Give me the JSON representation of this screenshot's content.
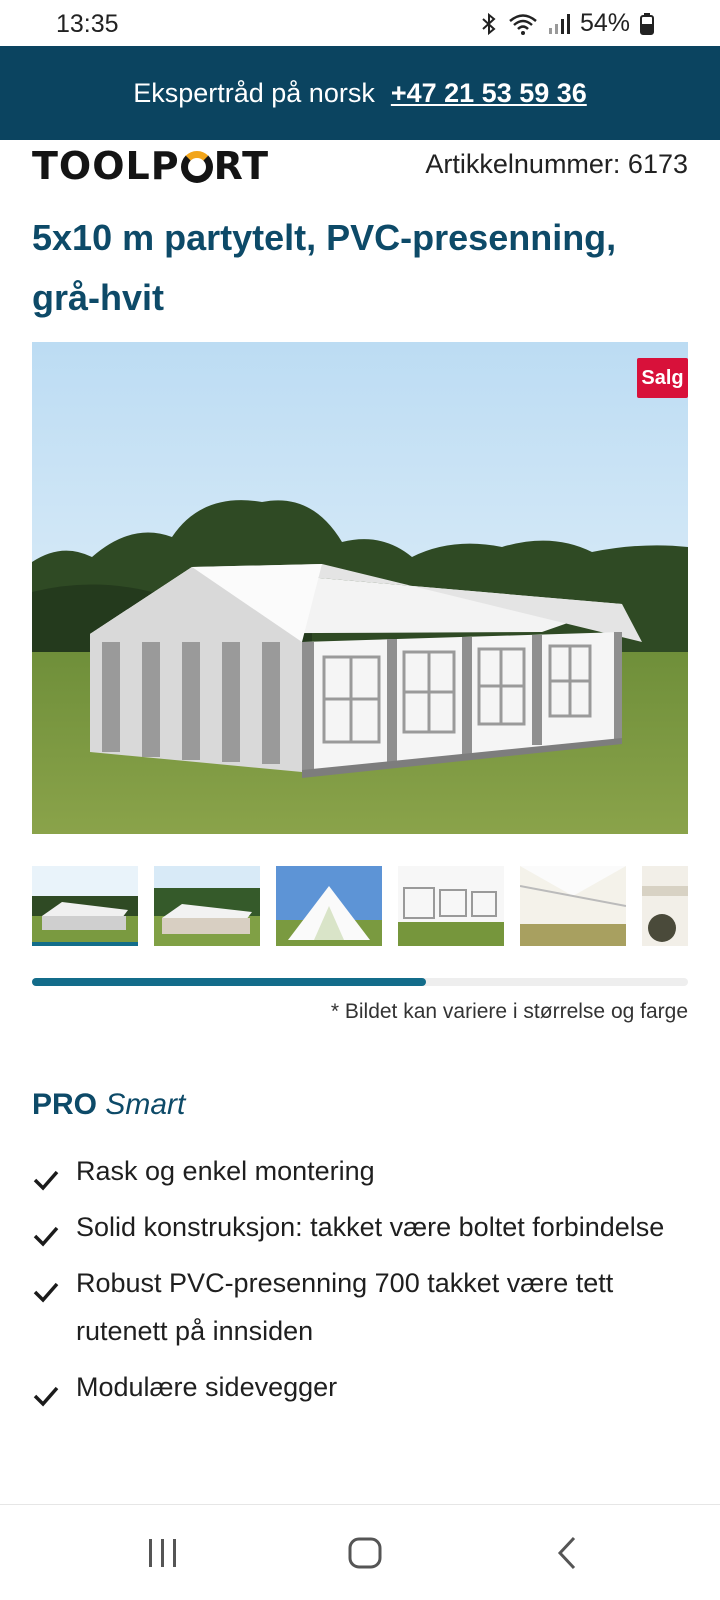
{
  "status": {
    "time": "13:35",
    "battery": "54%"
  },
  "banner": {
    "text": "Ekspertråd på norsk",
    "phone": "+47 21 53 59 36"
  },
  "header": {
    "logo": "TOOLPORT",
    "article_number": "Artikkelnummer: 6173"
  },
  "product": {
    "title": "5x10 m partytelt, PVC-presenning, grå-hvit",
    "sale_badge": "Salg"
  },
  "gallery": {
    "thumbnail_count": 6,
    "active_index": 0,
    "scroll_progress": 0.6,
    "note": "* Bildet kan variere i størrelse og farge"
  },
  "pro": {
    "strong": "PRO",
    "em": "Smart"
  },
  "features": [
    "Rask og enkel montering",
    "Solid konstruksjon: takket være boltet forbindelse",
    "Robust PVC-presenning 700 takket være tett rutenett på innsiden",
    "Modulære sidevegger"
  ],
  "colors": {
    "brand": "#0b4460",
    "title": "#0d4a68",
    "sale": "#d8113a",
    "progress": "#136c8a"
  }
}
